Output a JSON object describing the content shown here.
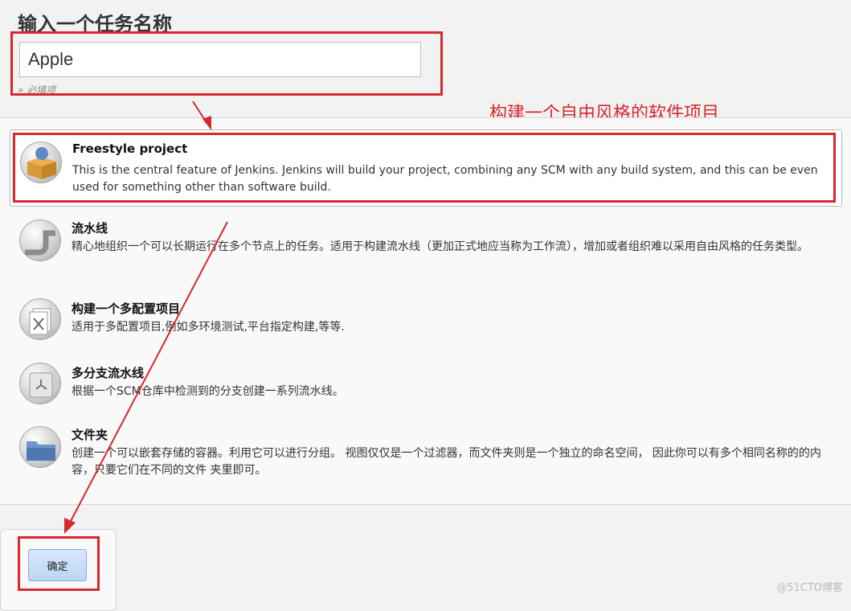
{
  "header": {
    "title": "输入一个任务名称",
    "item_name_value": "Apple",
    "required_hint": "» 必填项"
  },
  "annotation": {
    "text": "构建一个自由风格的软件项目",
    "color": "#d7282d"
  },
  "job_types": [
    {
      "title": "Freestyle project",
      "description": "This is the central feature of Jenkins. Jenkins will build your project, combining any SCM with any build system, and this can be even used for something other than software build.",
      "icon": "freestyle-box-icon"
    },
    {
      "title": "流水线",
      "description": "精心地组织一个可以长期运行在多个节点上的任务。适用于构建流水线（更加正式地应当称为工作流），增加或者组织难以采用自由风格的任务类型。",
      "icon": "pipeline-icon"
    },
    {
      "title": "构建一个多配置项目",
      "description": "适用于多配置项目,例如多环境测试,平台指定构建,等等.",
      "icon": "multi-config-icon"
    },
    {
      "title": "多分支流水线",
      "description": "根据一个SCM仓库中检测到的分支创建一系列流水线。",
      "icon": "multibranch-icon"
    },
    {
      "title": "文件夹",
      "description": "创建一个可以嵌套存储的容器。利用它可以进行分组。 视图仅仅是一个过滤器，而文件夹则是一个独立的命名空间， 因此你可以有多个相同名称的的内容，只要它们在不同的文件 夹里即可。",
      "icon": "folder-icon"
    }
  ],
  "footer": {
    "ok_label": "确定"
  },
  "watermark": "@51CTO博客"
}
